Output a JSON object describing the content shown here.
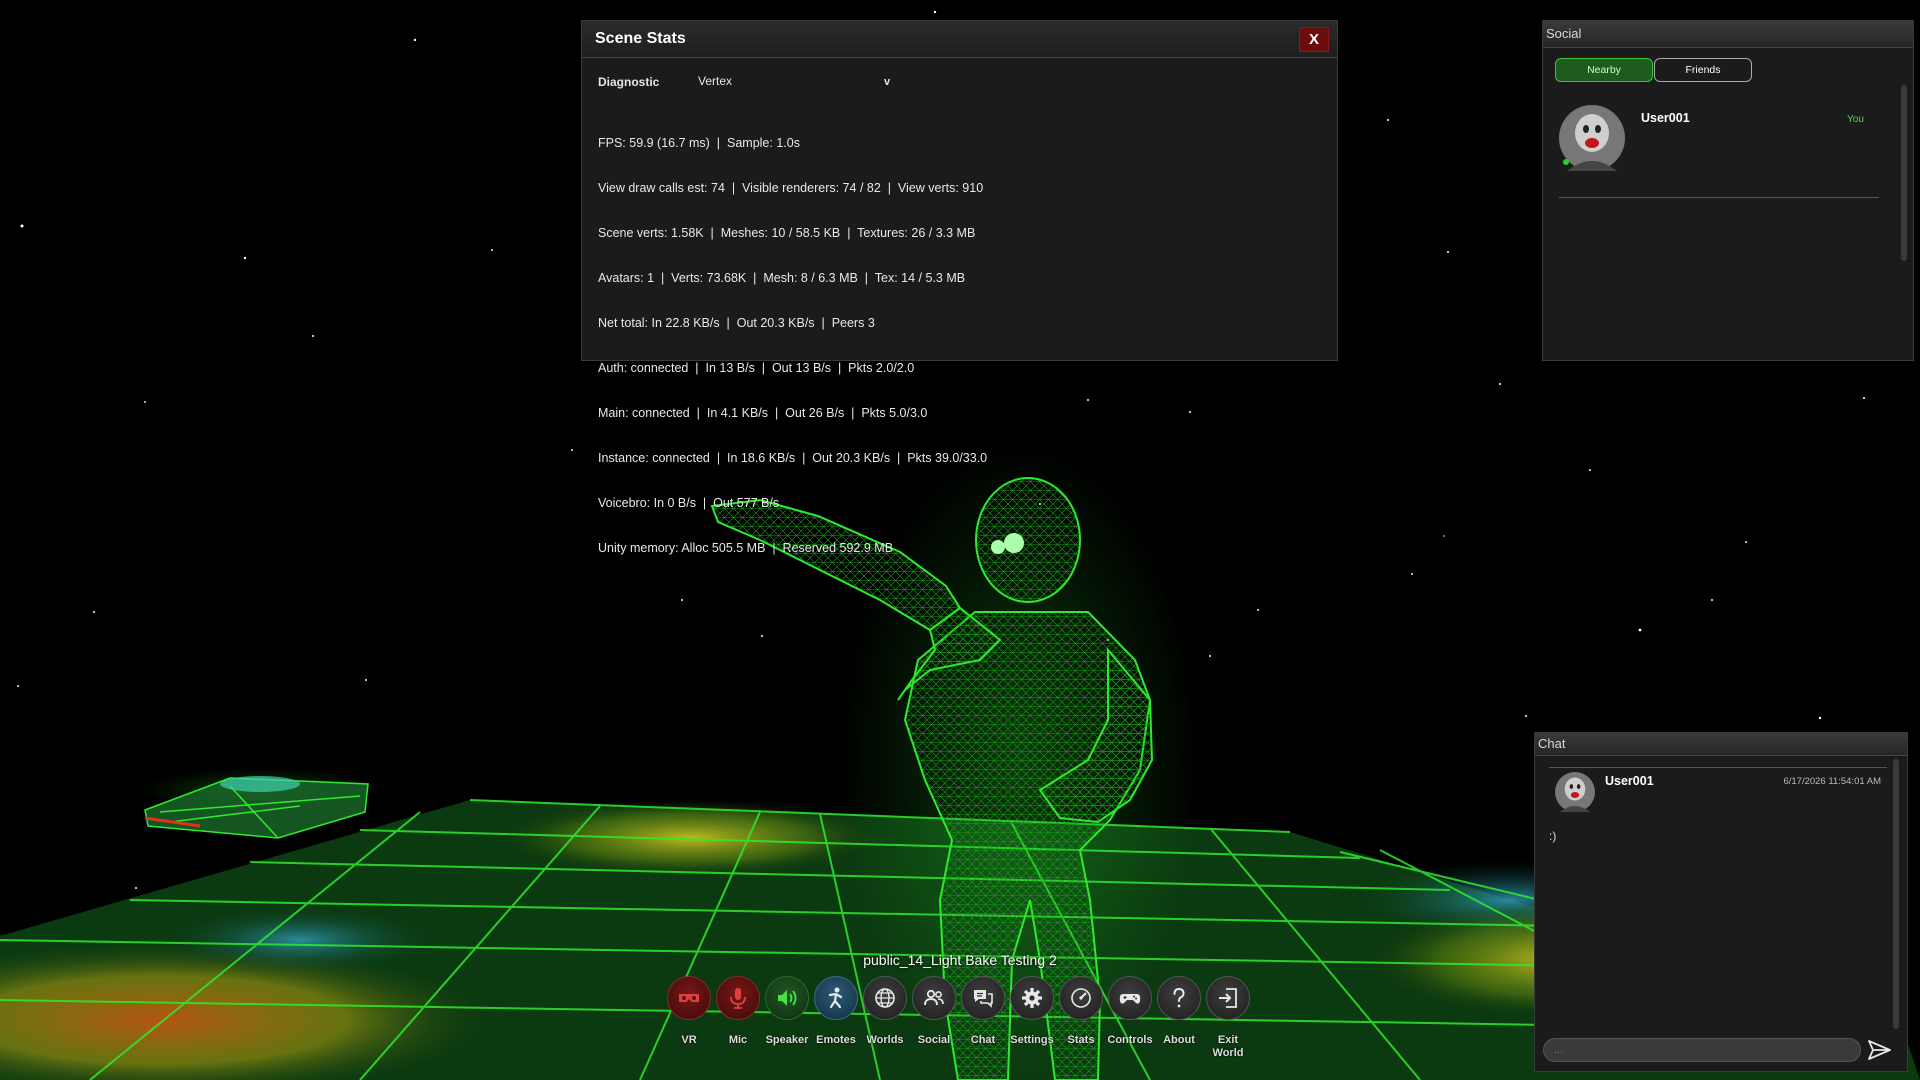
{
  "scene": {
    "colors": {
      "wireframe": "#2eea2e",
      "space": "#000000"
    }
  },
  "stats_panel": {
    "title": "Scene Stats",
    "close_label": "X",
    "diagnostic_label": "Diagnostic",
    "diagnostic_value": "Vertex",
    "dropdown_chevron": "v",
    "lines": [
      "FPS: 59.9 (16.7 ms)  |  Sample: 1.0s",
      "View draw calls est: 74  |  Visible renderers: 74 / 82  |  View verts: 910",
      "Scene verts: 1.58K  |  Meshes: 10 / 58.5 KB  |  Textures: 26 / 3.3 MB",
      "Avatars: 1  |  Verts: 73.68K  |  Mesh: 8 / 6.3 MB  |  Tex: 14 / 5.3 MB",
      "Net total: In 22.8 KB/s  |  Out 20.3 KB/s  |  Peers 3",
      "Auth: connected  |  In 13 B/s  |  Out 13 B/s  |  Pkts 2.0/2.0",
      "Main: connected  |  In 4.1 KB/s  |  Out 26 B/s  |  Pkts 5.0/3.0",
      "Instance: connected  |  In 18.6 KB/s  |  Out 20.3 KB/s  |  Pkts 39.0/33.0",
      "Voicebro: In 0 B/s  |  Out 577 B/s",
      "Unity memory: Alloc 505.5 MB  |  Reserved 592.9 MB"
    ]
  },
  "social_panel": {
    "title": "Social",
    "tabs": [
      "Nearby",
      "Friends"
    ],
    "active_tab": "Nearby",
    "users": [
      {
        "name": "User001",
        "tag": "You",
        "status": "online"
      }
    ]
  },
  "chat_panel": {
    "title": "Chat",
    "messages": [
      {
        "user": "User001",
        "timestamp": "6/17/2026 11:54:01 AM",
        "text": ":)"
      }
    ],
    "input_placeholder": "...",
    "send_icon": "send-icon"
  },
  "world_name": "public_14_Light Bake Testing 2",
  "toolbar": {
    "items": [
      {
        "label": "VR",
        "icon": "vr-headset-icon",
        "state": "off"
      },
      {
        "label": "Mic",
        "icon": "microphone-icon",
        "state": "off"
      },
      {
        "label": "Speaker",
        "icon": "speaker-icon",
        "state": "on"
      },
      {
        "label": "Emotes",
        "icon": "emote-icon",
        "state": "highlight"
      },
      {
        "label": "Worlds",
        "icon": "globe-icon",
        "state": "normal"
      },
      {
        "label": "Social",
        "icon": "people-icon",
        "state": "normal"
      },
      {
        "label": "Chat",
        "icon": "chat-bubbles-icon",
        "state": "normal"
      },
      {
        "label": "Settings",
        "icon": "gear-icon",
        "state": "normal"
      },
      {
        "label": "Stats",
        "icon": "gauge-icon",
        "state": "normal"
      },
      {
        "label": "Controls",
        "icon": "gamepad-icon",
        "state": "normal"
      },
      {
        "label": "About",
        "icon": "question-icon",
        "state": "normal"
      },
      {
        "label": "Exit World",
        "icon": "exit-icon",
        "state": "normal"
      }
    ]
  }
}
